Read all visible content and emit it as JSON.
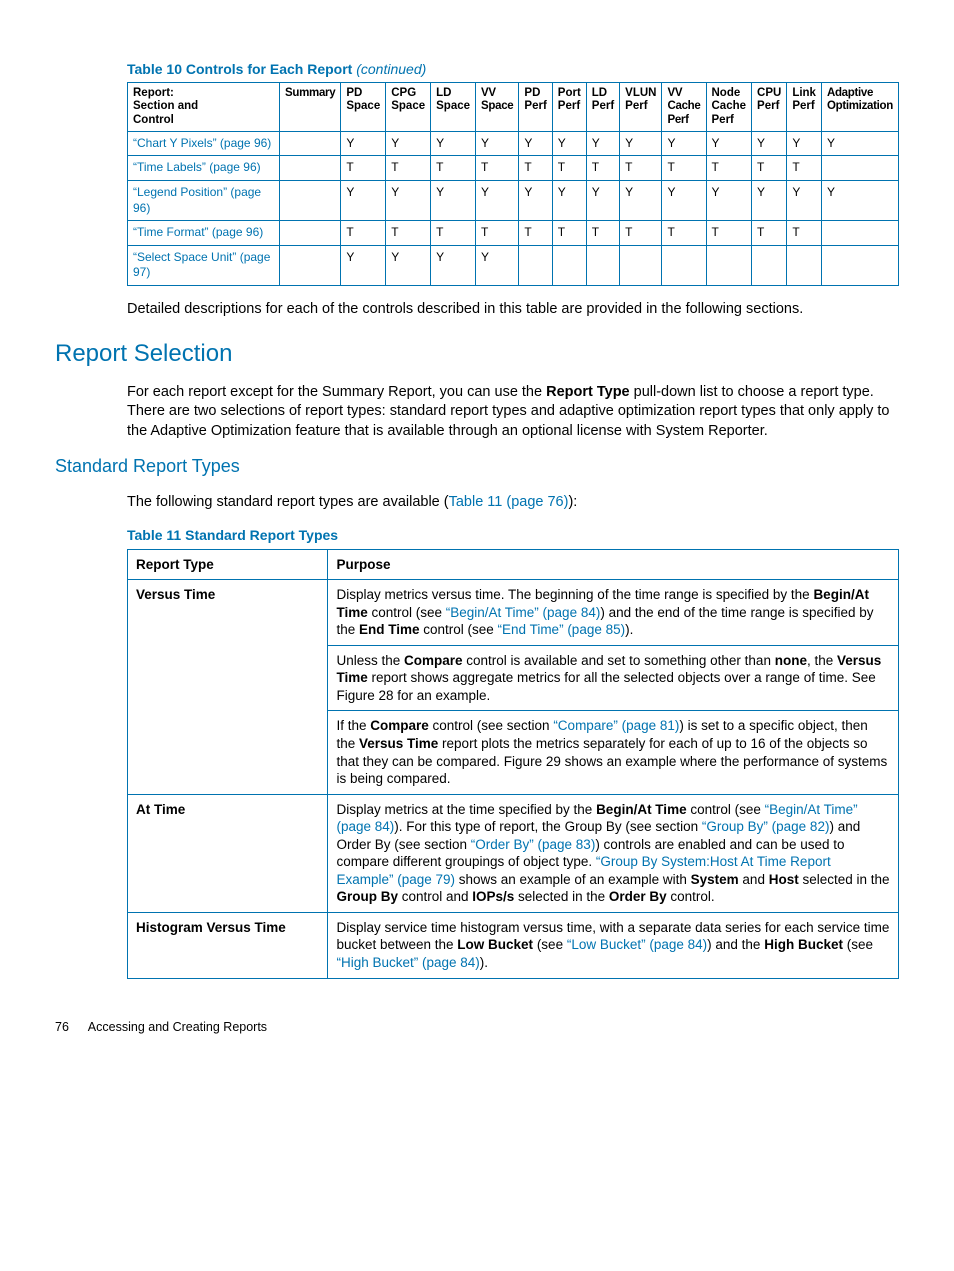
{
  "table10": {
    "caption_prefix": "Table 10 Controls for Each Report ",
    "caption_suffix": "(continued)",
    "headers": [
      "Report: Section and Control",
      "Summary",
      "PD Space",
      "CPG Space",
      "LD Space",
      "VV Space",
      "PD Perf",
      "Port Perf",
      "LD Perf",
      "VLUN Perf",
      "VV Cache Perf",
      "Node Cache Perf",
      "CPU Perf",
      "Link Perf",
      "Adaptive Optimization"
    ],
    "rows": [
      {
        "label_q": "“Chart Y Pixels”",
        "label_p": "(page 96)",
        "cells": [
          "",
          "Y",
          "Y",
          "Y",
          "Y",
          "Y",
          "Y",
          "Y",
          "Y",
          "Y",
          "Y",
          "Y",
          "Y",
          "Y"
        ]
      },
      {
        "label_q": "“Time Labels”",
        "label_p": "(page 96)",
        "cells": [
          "",
          "T",
          "T",
          "T",
          "T",
          "T",
          "T",
          "T",
          "T",
          "T",
          "T",
          "T",
          "T",
          ""
        ]
      },
      {
        "label_q": "“Legend Position”",
        "label_p": "(page 96)",
        "cells": [
          "",
          "Y",
          "Y",
          "Y",
          "Y",
          "Y",
          "Y",
          "Y",
          "Y",
          "Y",
          "Y",
          "Y",
          "Y",
          "Y"
        ]
      },
      {
        "label_q": "“Time Format”",
        "label_p": "(page 96)",
        "cells": [
          "",
          "T",
          "T",
          "T",
          "T",
          "T",
          "T",
          "T",
          "T",
          "T",
          "T",
          "T",
          "T",
          ""
        ]
      },
      {
        "label_q": "“Select Space Unit”",
        "label_p": "(page 97)",
        "cells": [
          "",
          "Y",
          "Y",
          "Y",
          "Y",
          "",
          "",
          "",
          "",
          "",
          "",
          "",
          "",
          ""
        ]
      }
    ]
  },
  "para1": "Detailed descriptions for each of the controls described in this table are provided in the following sections.",
  "h2": "Report Selection",
  "para2_a": "For each report except for the Summary Report, you can use the ",
  "para2_b": "Report Type",
  "para2_c": " pull-down list to choose a report type. There are two selections of report types: standard report types and adaptive optimization report types that only apply to the Adaptive Optimization feature that is available through an optional license with System Reporter.",
  "h3": "Standard Report Types",
  "para3_a": "The following standard report types are available (",
  "para3_link": "Table 11 (page 76)",
  "para3_b": "):",
  "table11": {
    "caption": "Table 11 Standard Report Types",
    "h1": "Report Type",
    "h2": "Purpose",
    "rows": [
      {
        "rt": "Versus Time",
        "purpose": [
          {
            "frags": [
              {
                "t": "Display metrics versus time. The beginning of the time range is specified by the "
              },
              {
                "t": "Begin/At Time",
                "b": true
              },
              {
                "t": " control (see "
              },
              {
                "t": "“Begin/At Time” (page 84)",
                "l": true
              },
              {
                "t": ") and the end of the time range is specified by the "
              },
              {
                "t": "End Time",
                "b": true
              },
              {
                "t": " control (see "
              },
              {
                "t": "“End Time” (page 85)",
                "l": true
              },
              {
                "t": ")."
              }
            ]
          },
          {
            "frags": [
              {
                "t": "Unless the "
              },
              {
                "t": "Compare",
                "b": true
              },
              {
                "t": " control is available and set to something other than "
              },
              {
                "t": "none",
                "b": true
              },
              {
                "t": ", the "
              },
              {
                "t": "Versus Time",
                "b": true
              },
              {
                "t": " report shows aggregate metrics for all the selected objects over a range of time. See Figure 28 for an example."
              }
            ]
          },
          {
            "frags": [
              {
                "t": "If the "
              },
              {
                "t": "Compare",
                "b": true
              },
              {
                "t": " control (see section "
              },
              {
                "t": "“Compare” (page 81)",
                "l": true
              },
              {
                "t": ") is set to a specific object, then the "
              },
              {
                "t": "Versus Time",
                "b": true
              },
              {
                "t": " report plots the metrics separately for each of up to 16 of the objects so that they can be compared. Figure 29 shows an example where the performance of systems is being compared."
              }
            ]
          }
        ]
      },
      {
        "rt": "At Time",
        "purpose": [
          {
            "frags": [
              {
                "t": "Display metrics at the time specified by the "
              },
              {
                "t": "Begin/At Time",
                "b": true
              },
              {
                "t": " control (see "
              },
              {
                "t": "“Begin/At Time” (page 84)",
                "l": true
              },
              {
                "t": "). For this type of report, the Group By (see section "
              },
              {
                "t": "“Group By” (page 82)",
                "l": true
              },
              {
                "t": ") and Order By (see section "
              },
              {
                "t": "“Order By” (page 83)",
                "l": true
              },
              {
                "t": ") controls are enabled and can be used to compare different groupings of object type. "
              },
              {
                "t": "“Group By System:Host At Time Report Example” (page 79)",
                "l": true
              },
              {
                "t": " shows an example of an example with "
              },
              {
                "t": "System",
                "b": true
              },
              {
                "t": " and "
              },
              {
                "t": "Host",
                "b": true
              },
              {
                "t": " selected in the "
              },
              {
                "t": "Group By",
                "b": true
              },
              {
                "t": " control and "
              },
              {
                "t": "IOPs/s",
                "b": true
              },
              {
                "t": " selected in the "
              },
              {
                "t": "Order By",
                "b": true
              },
              {
                "t": " control."
              }
            ]
          }
        ]
      },
      {
        "rt": "Histogram Versus Time",
        "purpose": [
          {
            "frags": [
              {
                "t": "Display service time histogram versus time, with a separate data series for each service time bucket between the "
              },
              {
                "t": "Low Bucket",
                "b": true
              },
              {
                "t": " (see "
              },
              {
                "t": "“Low Bucket” (page 84)",
                "l": true
              },
              {
                "t": ") and the "
              },
              {
                "t": "High Bucket",
                "b": true
              },
              {
                "t": " (see "
              },
              {
                "t": "“High Bucket” (page 84)",
                "l": true
              },
              {
                "t": ")."
              }
            ]
          }
        ]
      }
    ]
  },
  "footer": {
    "page": "76",
    "title": "Accessing and Creating Reports"
  }
}
